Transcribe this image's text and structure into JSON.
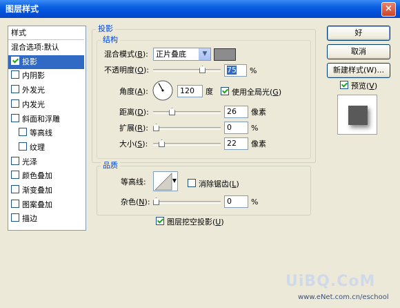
{
  "window": {
    "title": "图层样式",
    "close_symbol": "×"
  },
  "left_panel": {
    "header": "样式",
    "items": [
      {
        "label": "混合选项:默认",
        "checkbox": false,
        "checked": false,
        "indent": false,
        "selected": false
      },
      {
        "label": "投影",
        "checkbox": true,
        "checked": true,
        "indent": false,
        "selected": true
      },
      {
        "label": "内阴影",
        "checkbox": true,
        "checked": false,
        "indent": false,
        "selected": false
      },
      {
        "label": "外发光",
        "checkbox": true,
        "checked": false,
        "indent": false,
        "selected": false
      },
      {
        "label": "内发光",
        "checkbox": true,
        "checked": false,
        "indent": false,
        "selected": false
      },
      {
        "label": "斜面和浮雕",
        "checkbox": true,
        "checked": false,
        "indent": false,
        "selected": false
      },
      {
        "label": "等高线",
        "checkbox": true,
        "checked": false,
        "indent": true,
        "selected": false
      },
      {
        "label": "纹理",
        "checkbox": true,
        "checked": false,
        "indent": true,
        "selected": false
      },
      {
        "label": "光泽",
        "checkbox": true,
        "checked": false,
        "indent": false,
        "selected": false
      },
      {
        "label": "颜色叠加",
        "checkbox": true,
        "checked": false,
        "indent": false,
        "selected": false
      },
      {
        "label": "渐变叠加",
        "checkbox": true,
        "checked": false,
        "indent": false,
        "selected": false
      },
      {
        "label": "图案叠加",
        "checkbox": true,
        "checked": false,
        "indent": false,
        "selected": false
      },
      {
        "label": "描边",
        "checkbox": true,
        "checked": false,
        "indent": false,
        "selected": false
      }
    ]
  },
  "drop_shadow": {
    "section_title": "投影",
    "structure": {
      "title": "结构",
      "blend_mode": {
        "label": "混合模式(",
        "key": "B",
        "suffix": "):",
        "value": "正片叠底",
        "color": "#8c8c8c"
      },
      "opacity": {
        "label": "不透明度(",
        "key": "O",
        "suffix": "):",
        "value": "75",
        "unit": "%",
        "level": 0.75
      },
      "angle": {
        "label": "角度(",
        "key": "A",
        "suffix": "):",
        "value": "120",
        "unit": "度",
        "degrees": 120
      },
      "global_light": {
        "label": "使用全局光(",
        "key": "G",
        "suffix": ")",
        "checked": true
      },
      "distance": {
        "label": "距离(",
        "key": "D",
        "suffix": "):",
        "value": "26",
        "unit": "像素",
        "level": 0.26
      },
      "spread": {
        "label": "扩展(",
        "key": "R",
        "suffix": "):",
        "value": "0",
        "unit": "%",
        "level": 0.0
      },
      "size": {
        "label": "大小(",
        "key": "S",
        "suffix": "):",
        "value": "22",
        "unit": "像素",
        "level": 0.09
      }
    },
    "quality": {
      "title": "品质",
      "contour": {
        "label": "等高线:"
      },
      "anti_alias": {
        "label": "消除锯齿(",
        "key": "L",
        "suffix": ")",
        "checked": false
      },
      "noise": {
        "label": "杂色(",
        "key": "N",
        "suffix": "):",
        "value": "0",
        "unit": "%",
        "level": 0.0
      }
    },
    "knockout": {
      "label": "图层挖空投影(",
      "key": "U",
      "suffix": ")",
      "checked": true
    }
  },
  "buttons": {
    "ok": "好",
    "cancel": "取消",
    "new_style": "新建样式(W)..."
  },
  "preview": {
    "label": "预览(",
    "key": "V",
    "suffix": ")",
    "checked": true
  },
  "watermark": {
    "logo": "UiBQ.CoM",
    "url": "www.eNet.com.cn/eschool"
  }
}
